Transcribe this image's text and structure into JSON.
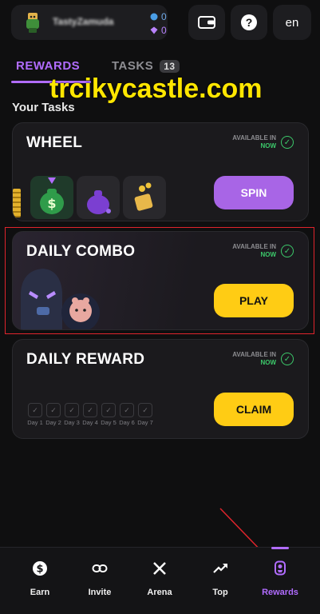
{
  "header": {
    "username": "TastyZamuda",
    "stat_blue": "0",
    "stat_purple": "0",
    "language": "en",
    "icons": {
      "avatar": "avatar-image",
      "wallet": "wallet-icon",
      "help": "help-icon"
    }
  },
  "tabs": [
    {
      "label": "REWARDS",
      "active": true
    },
    {
      "label": "TASKS",
      "badge": "13"
    }
  ],
  "watermark": "trcikycastle.com",
  "section_title": "Your Tasks",
  "cards": {
    "wheel": {
      "title": "WHEEL",
      "avail_label": "AVAILABLE IN",
      "avail_value": "NOW",
      "button": "SPIN"
    },
    "combo": {
      "title": "DAILY COMBO",
      "avail_label": "AVAILABLE IN",
      "avail_value": "NOW",
      "button": "PLAY"
    },
    "reward": {
      "title": "DAILY REWARD",
      "avail_label": "AVAILABLE IN",
      "avail_value": "NOW",
      "button": "CLAIM",
      "days": [
        "Day 1",
        "Day 2",
        "Day 3",
        "Day 4",
        "Day 5",
        "Day 6",
        "Day 7"
      ]
    }
  },
  "nav": [
    {
      "label": "Earn",
      "icon": "dollar-icon"
    },
    {
      "label": "Invite",
      "icon": "link-icon"
    },
    {
      "label": "Arena",
      "icon": "swords-icon"
    },
    {
      "label": "Top",
      "icon": "trend-up-icon"
    },
    {
      "label": "Rewards",
      "icon": "medal-icon",
      "active": true
    }
  ],
  "colors": {
    "accent": "#b16cff",
    "yellow": "#ffcc14",
    "green": "#3cc96a",
    "highlight": "#e0242c"
  }
}
